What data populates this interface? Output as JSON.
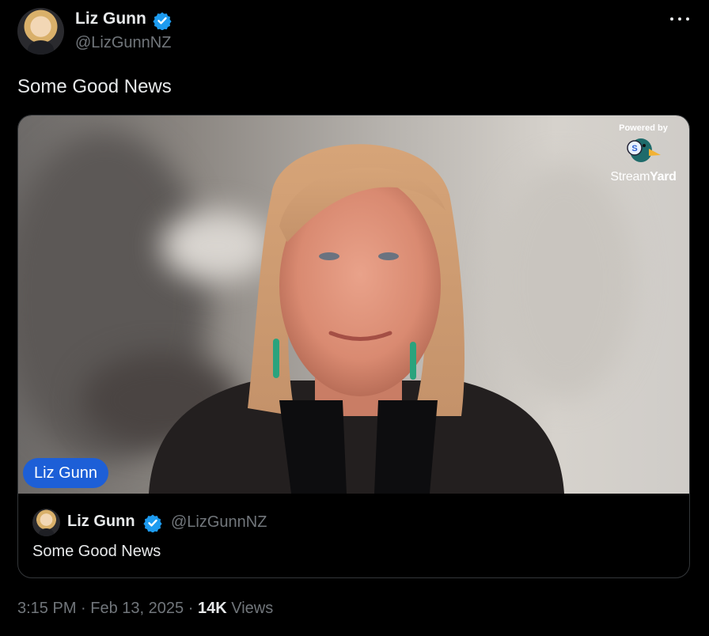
{
  "header": {
    "name": "Liz Gunn",
    "handle": "@LizGunnNZ",
    "verified_icon": "verified-badge-icon",
    "more_icon": "more-options-icon"
  },
  "tweet": {
    "text": "Some Good News"
  },
  "video": {
    "watermark_powered": "Powered by",
    "watermark_brand_a": "Stream",
    "watermark_brand_b": "Yard",
    "name_tag": "Liz Gunn"
  },
  "quoted": {
    "name": "Liz Gunn",
    "handle": "@LizGunnNZ",
    "text": "Some Good News"
  },
  "meta": {
    "time": "3:15 PM",
    "date": "Feb 13, 2025",
    "separator": "·",
    "views_count": "14K",
    "views_label": "Views"
  },
  "colors": {
    "background": "#000000",
    "text": "#e7e9ea",
    "secondary": "#71767b",
    "verified": "#1d9bf0",
    "name_tag": "#1d5fd7"
  }
}
